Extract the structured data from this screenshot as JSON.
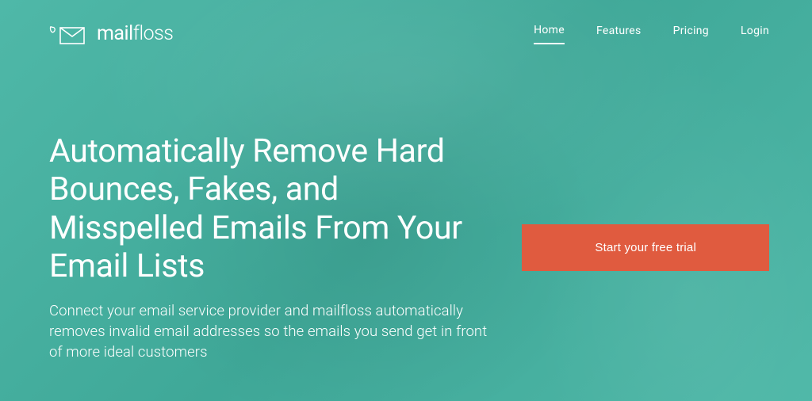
{
  "brand": {
    "name_prefix": "mail",
    "name_suffix": "floss"
  },
  "nav": {
    "items": [
      {
        "label": "Home",
        "active": true
      },
      {
        "label": "Features",
        "active": false
      },
      {
        "label": "Pricing",
        "active": false
      },
      {
        "label": "Login",
        "active": false
      }
    ]
  },
  "hero": {
    "headline": "Automatically Remove Hard Bounces, Fakes, and Misspelled Emails From Your Email Lists",
    "subheadline": "Connect your email service provider and mailfloss automatically removes invalid email addresses so the emails you send get in front of more ideal customers",
    "cta_label": "Start your free trial"
  }
}
